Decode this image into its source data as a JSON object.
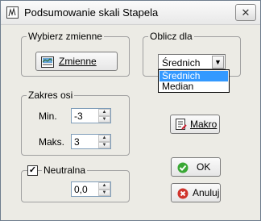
{
  "window": {
    "title": "Podsumowanie skali Stapela",
    "close_glyph": "✕"
  },
  "variables": {
    "legend": "Wybierz zmienne",
    "button_label": "Zmienne"
  },
  "compute": {
    "legend": "Oblicz dla",
    "selected": "Średnich",
    "options": [
      "Średnich",
      "Median"
    ],
    "highlighted_index": 0
  },
  "axis": {
    "legend": "Zakres osi",
    "min_label": "Min.",
    "min_value": "-3",
    "max_label": "Maks.",
    "max_value": "3"
  },
  "neutral": {
    "label": "Neutralna",
    "checked": true,
    "check_glyph": "✓",
    "value": "0,0"
  },
  "buttons": {
    "macro": "Makro",
    "ok": "OK",
    "cancel": "Anuluj"
  },
  "icons": {
    "close": "close-icon",
    "app": "chart-icon",
    "variables": "table-icon",
    "macro": "macro-icon",
    "ok": "check-circle-icon",
    "cancel": "x-circle-icon"
  },
  "colors": {
    "ok_green": "#3aa835",
    "cancel_red": "#d0342c",
    "highlight": "#3399ff"
  }
}
